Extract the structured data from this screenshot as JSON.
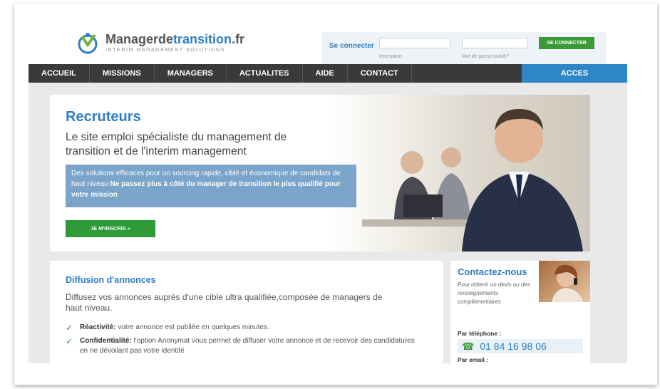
{
  "header": {
    "logo_name_part1": "Manager",
    "logo_name_part2": "de",
    "logo_name_part3": "transition",
    "logo_name_part4": ".fr",
    "logo_tagline": "INTERIM MANAGEMENT SOLUTIONS",
    "login_label": "Se connecter",
    "signup_link": "Inscription",
    "forgot_link": "Mot de passe oublié?",
    "connect_button": "SE CONNECTER"
  },
  "nav": {
    "items": [
      "ACCUEIL",
      "MISSIONS",
      "MANAGERS",
      "ACTUALITES",
      "AIDE",
      "CONTACT"
    ],
    "recruiters": "ACCES RECRUTEURS"
  },
  "hero": {
    "title": "Recruteurs",
    "subtitle": "Le site emploi spécialiste du management de transition et de l'interim management",
    "box_text": "Des solutions efficaces pour un sourcing rapide, ciblé et économique de candidats de haut niveau",
    "box_bold": "Ne passez plus à côté du manager de transition le plus qualifié pour votre mission",
    "cta": "JE M'INSCRIS »"
  },
  "diffusion": {
    "title": "Diffusion d'annonces",
    "text": "Diffusez vos annonces auprès d'une cible ultra qualifiée,composée de managers de haut niveau.",
    "items": [
      {
        "bold": "Réactivité:",
        "text": "votre annonce est publiée en quelques minutes."
      },
      {
        "bold": "Confidentialité:",
        "text": "l'option Anonymat vous permet de diffuser votre annonce et de recevoir des candidatures en ne dévoilant pas votre identité"
      }
    ]
  },
  "contact": {
    "title": "Contactez-nous",
    "subtitle": "Pour obtenir un devis ou des renseignements complémentaires",
    "phone_label": "Par téléphone :",
    "phone": "01 84 16 98 06",
    "email_label": "Par email :"
  },
  "colors": {
    "accent": "#2f7fc2",
    "green": "#3a9a3a",
    "nav": "#3a3a3a"
  }
}
